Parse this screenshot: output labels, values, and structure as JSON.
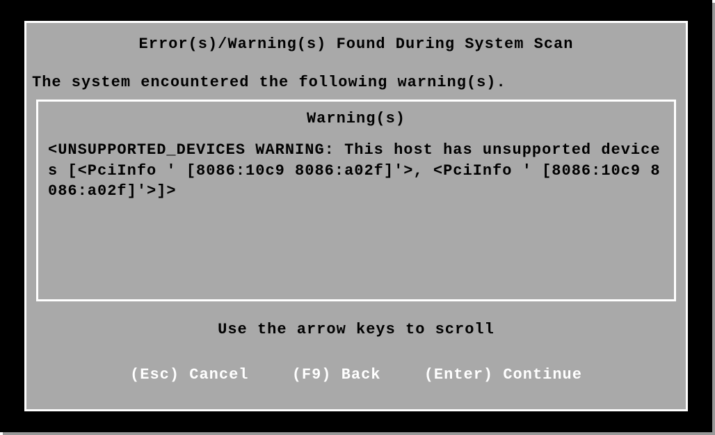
{
  "dialog": {
    "title": "Error(s)/Warning(s) Found During System Scan",
    "intro": "The system encountered the following warning(s).",
    "warning_box": {
      "header": "Warning(s)",
      "body": "<UNSUPPORTED_DEVICES WARNING: This host has unsupported devices [<PciInfo ' [8086:10c9 8086:a02f]'>, <PciInfo ' [8086:10c9 8086:a02f]'>]>"
    },
    "scroll_hint": "Use the arrow keys to scroll",
    "keys": {
      "cancel": "(Esc) Cancel",
      "back": "(F9) Back",
      "continue": "(Enter) Continue"
    }
  }
}
